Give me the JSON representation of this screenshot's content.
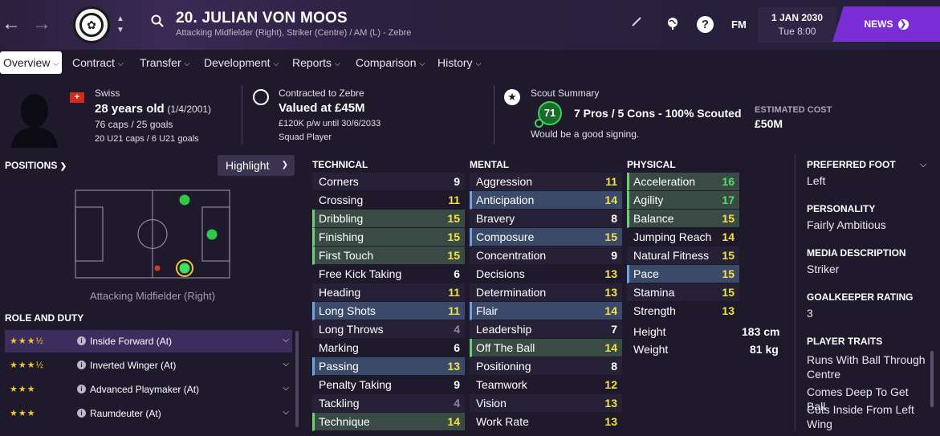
{
  "header": {
    "player_title": "20. JULIAN VON MOOS",
    "player_subtitle": "Attacking Midfielder (Right), Striker (Centre) / AM (L) - Zebre",
    "fm_logo": "FM",
    "date_main": "1 JAN 2030",
    "date_sub": "Tue 8:00",
    "news_label": "NEWS",
    "help_label": "?"
  },
  "tabs": [
    {
      "label": "Overview"
    },
    {
      "label": "Contract"
    },
    {
      "label": "Transfer"
    },
    {
      "label": "Development"
    },
    {
      "label": "Reports"
    },
    {
      "label": "Comparison"
    },
    {
      "label": "History"
    }
  ],
  "info": {
    "nationality": "Swiss",
    "age": "28 years old",
    "dob": "(1/4/2001)",
    "caps": "76 caps / 25 goals",
    "u21": "20 U21 caps / 6 U21 goals",
    "contract_label": "Contracted to Zebre",
    "value": "Valued at £45M",
    "wage": "£120K p/w until 30/6/2033",
    "squad_status": "Squad Player",
    "scout_title": "Scout Summary",
    "scout_rating": "71",
    "scout_summary": "7 Pros / 5 Cons - 100% Scouted",
    "scout_note": "Would be a good signing.",
    "est_cost_label": "ESTIMATED COST",
    "est_cost_value": "£50M"
  },
  "positions": {
    "header": "POSITIONS",
    "highlight_label": "Highlight",
    "position_label": "Attacking Midfielder (Right)"
  },
  "roles": {
    "header": "ROLE AND DUTY",
    "items": [
      {
        "stars": "★★★½",
        "name": "Inside Forward (At)"
      },
      {
        "stars": "★★★½",
        "name": "Inverted Winger (At)"
      },
      {
        "stars": "★★★",
        "name": "Advanced Playmaker (At)"
      },
      {
        "stars": "★★★",
        "name": "Raumdeuter (At)"
      }
    ]
  },
  "attributes": {
    "technical_header": "TECHNICAL",
    "mental_header": "MENTAL",
    "physical_header": "PHYSICAL",
    "technical": [
      {
        "name": "Corners",
        "value": "9"
      },
      {
        "name": "Crossing",
        "value": "11"
      },
      {
        "name": "Dribbling",
        "value": "15"
      },
      {
        "name": "Finishing",
        "value": "15"
      },
      {
        "name": "First Touch",
        "value": "15"
      },
      {
        "name": "Free Kick Taking",
        "value": "6"
      },
      {
        "name": "Heading",
        "value": "11"
      },
      {
        "name": "Long Shots",
        "value": "11"
      },
      {
        "name": "Long Throws",
        "value": "4"
      },
      {
        "name": "Marking",
        "value": "6"
      },
      {
        "name": "Passing",
        "value": "13"
      },
      {
        "name": "Penalty Taking",
        "value": "9"
      },
      {
        "name": "Tackling",
        "value": "4"
      },
      {
        "name": "Technique",
        "value": "14"
      }
    ],
    "mental": [
      {
        "name": "Aggression",
        "value": "11"
      },
      {
        "name": "Anticipation",
        "value": "14"
      },
      {
        "name": "Bravery",
        "value": "8"
      },
      {
        "name": "Composure",
        "value": "15"
      },
      {
        "name": "Concentration",
        "value": "9"
      },
      {
        "name": "Decisions",
        "value": "13"
      },
      {
        "name": "Determination",
        "value": "13"
      },
      {
        "name": "Flair",
        "value": "14"
      },
      {
        "name": "Leadership",
        "value": "7"
      },
      {
        "name": "Off The Ball",
        "value": "14"
      },
      {
        "name": "Positioning",
        "value": "8"
      },
      {
        "name": "Teamwork",
        "value": "12"
      },
      {
        "name": "Vision",
        "value": "13"
      },
      {
        "name": "Work Rate",
        "value": "13"
      }
    ],
    "physical": [
      {
        "name": "Acceleration",
        "value": "16"
      },
      {
        "name": "Agility",
        "value": "17"
      },
      {
        "name": "Balance",
        "value": "15"
      },
      {
        "name": "Jumping Reach",
        "value": "14"
      },
      {
        "name": "Natural Fitness",
        "value": "15"
      },
      {
        "name": "Pace",
        "value": "15"
      },
      {
        "name": "Stamina",
        "value": "15"
      },
      {
        "name": "Strength",
        "value": "13"
      }
    ],
    "height_label": "Height",
    "height_value": "183 cm",
    "weight_label": "Weight",
    "weight_value": "81 kg"
  },
  "profile": {
    "foot_header": "PREFERRED FOOT",
    "foot_value": "Left",
    "personality_header": "PERSONALITY",
    "personality_value": "Fairly Ambitious",
    "media_header": "MEDIA DESCRIPTION",
    "media_value": "Striker",
    "gk_header": "GOALKEEPER RATING",
    "gk_value": "3",
    "traits_header": "PLAYER TRAITS",
    "traits": [
      "Runs With Ball Through Centre",
      "Comes Deep To Get Ball",
      "Cuts Inside From Left Wing"
    ]
  },
  "colors": {
    "accent": "#7b2ed6",
    "attr_high": "#4ee26a",
    "attr_good": "#f2e24a",
    "attr_low": "#8e889e",
    "selected_role": "#3d2d5e"
  }
}
